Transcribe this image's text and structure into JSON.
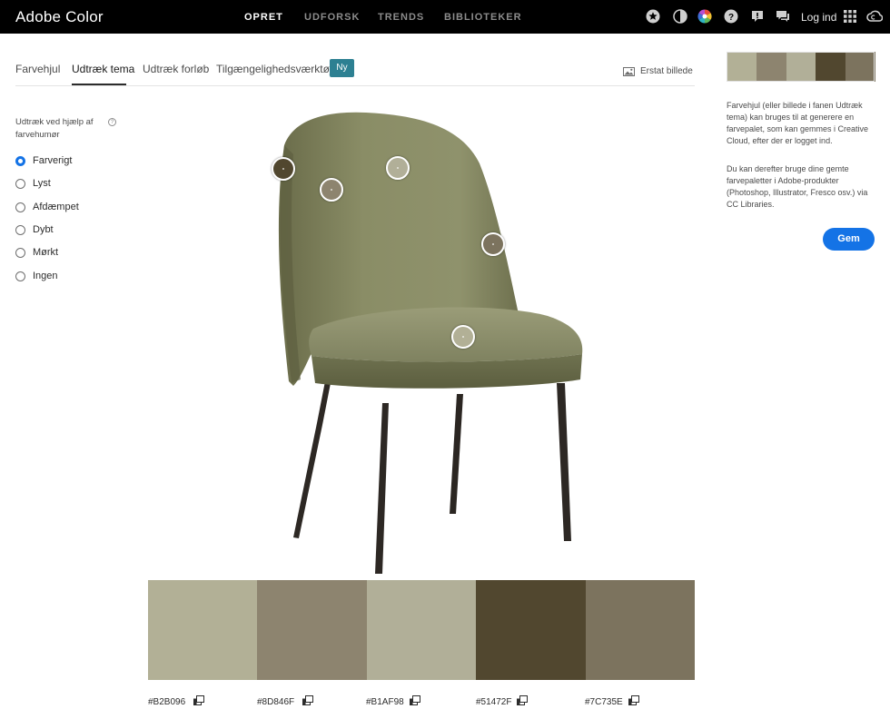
{
  "header": {
    "brand": "Adobe Color",
    "nav": [
      "OPRET",
      "UDFORSK",
      "TRENDS",
      "BIBLIOTEKER"
    ],
    "active_nav": "OPRET",
    "login": "Log ind"
  },
  "tabs": {
    "items": [
      "Farvehjul",
      "Udtræk tema",
      "Udtræk forløb",
      "Tilgængelighedsværktøjer"
    ],
    "active": "Udtræk tema",
    "new_badge": "Ny",
    "replace_image": "Erstat billede"
  },
  "mood": {
    "label": "Udtræk ved hjælp af farvehumør",
    "help": "?",
    "options": [
      "Farverigt",
      "Lyst",
      "Afdæmpet",
      "Dybt",
      "Mørkt",
      "Ingen"
    ],
    "selected": "Farverigt"
  },
  "palette": [
    {
      "hex": "#B2B096"
    },
    {
      "hex": "#8D846F"
    },
    {
      "hex": "#B1AF98"
    },
    {
      "hex": "#51472F"
    },
    {
      "hex": "#7C735E"
    }
  ],
  "colors": {
    "accent": "#1473e6",
    "badge": "#2d8092",
    "seat": "#7a7c5a",
    "legs": "#2d2824"
  },
  "side_panel": {
    "info1": "Farvehjul (eller billede i fanen Udtræk tema) kan bruges til at generere en farvepalet, som kan gemmes i Creative Cloud, efter der er logget ind.",
    "info2": "Du kan derefter bruge dine gemte farvepaletter i Adobe-produkter (Photoshop, Illustrator, Fresco osv.) via CC Libraries.",
    "save": "Gem"
  }
}
